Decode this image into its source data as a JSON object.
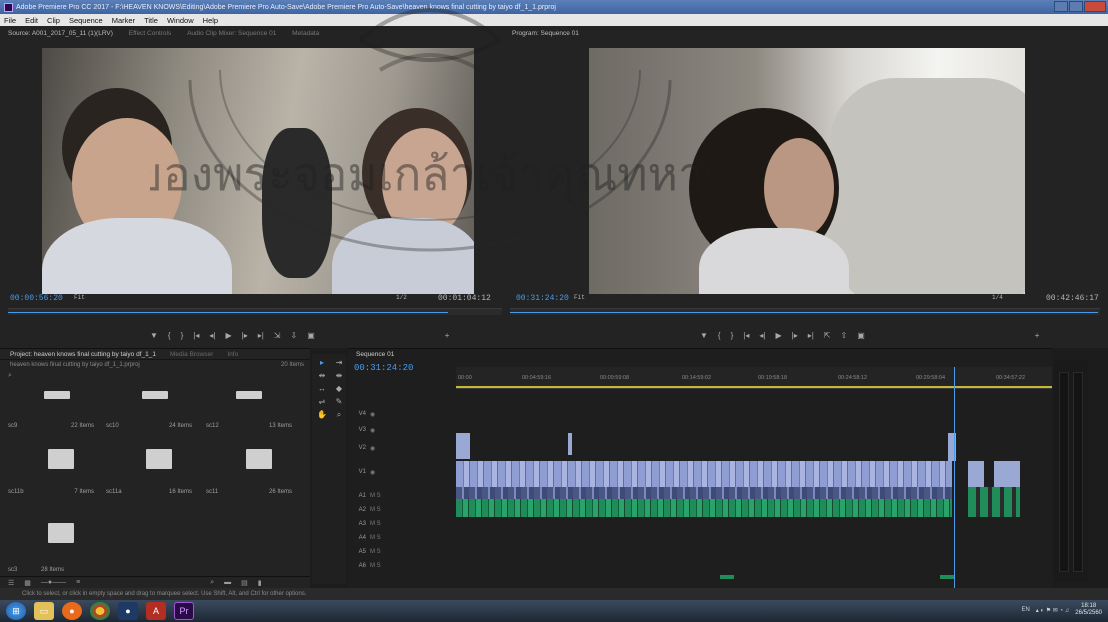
{
  "window": {
    "title": "Adobe Premiere Pro CC 2017 - F:\\HEAVEN KNOWS\\Editing\\Adobe Premiere Pro Auto-Save\\Adobe Premiere Pro Auto-Save\\heaven knows final cutting by taiyo df_1_1.prproj"
  },
  "menu": [
    "File",
    "Edit",
    "Clip",
    "Sequence",
    "Marker",
    "Title",
    "Window",
    "Help"
  ],
  "source_monitor": {
    "tab_label": "Source: A001_2017_05_11 (1)(LRV)",
    "tab_effect_controls": "Effect Controls",
    "tab_audio_clip_mixer": "Audio Clip Mixer: Sequence 01",
    "tab_metadata": "Metadata",
    "in_timecode": "00:00:56:20",
    "fit": "Fit",
    "resolution": "1/2",
    "duration": "00:01:04:12"
  },
  "program_monitor": {
    "tab_label": "Program: Sequence 01",
    "timecode": "00:31:24:20",
    "fit": "Fit",
    "resolution": "1/4",
    "duration": "00:42:46:17"
  },
  "project": {
    "tab_label": "Project: heaven knows final cutting by taiyo df_1_1",
    "tab_media_browser": "Media Browser",
    "tab_info": "Info",
    "path": "heaven knows final cutting by taiyo df_1_1.prproj",
    "item_count": "20 Items",
    "bins": [
      {
        "name": "sc9",
        "count": "22 Items"
      },
      {
        "name": "sc10",
        "count": "24 Items"
      },
      {
        "name": "sc12",
        "count": "13 Items"
      },
      {
        "name": "sc11b",
        "count": "7 Items"
      },
      {
        "name": "sc11a",
        "count": "16 Items"
      },
      {
        "name": "sc11",
        "count": "26 Items"
      },
      {
        "name": "sc3",
        "count": "28 Items"
      }
    ]
  },
  "timeline": {
    "tab_label": "Sequence 01",
    "timecode": "00:31:24:20",
    "ruler": [
      "00:00",
      "00:04:59:16",
      "00:09:59:08",
      "00:14:59:02",
      "00:19:58:18",
      "00:24:58:12",
      "00:29:58:04",
      "00:34:57:22"
    ],
    "tracks": [
      "V4",
      "V3",
      "V2",
      "V1",
      "A1",
      "A2",
      "A3",
      "A4",
      "A5",
      "A6"
    ]
  },
  "status_text": "Click to select, or click in empty space and drag to marquee select. Use Shift, Alt, and Ctrl for other options.",
  "taskbar": {
    "lang": "EN",
    "time": "18:18",
    "date": "26/5/2560"
  },
  "watermark_text": "ของพระจอมเกล้าเจ้าคุณทหาร"
}
